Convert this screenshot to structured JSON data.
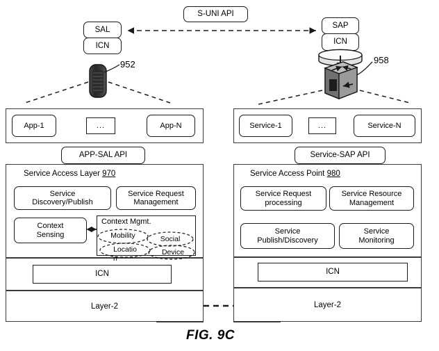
{
  "figure": {
    "caption": "FIG. 9C",
    "top_api_label": "S-UNI API"
  },
  "left": {
    "stack": {
      "top_label": "SAL",
      "bottom_label": "ICN"
    },
    "device": {
      "icon": "mobile-phone-icon",
      "ref_number": "952"
    },
    "apps_panel": {
      "items": [
        {
          "label": "App-1"
        },
        {
          "label": "..."
        },
        {
          "label": "App-N"
        }
      ]
    },
    "api_label": "APP-SAL API",
    "layer_panel": {
      "title": "Service Access Layer",
      "ref_number": "970",
      "blocks": [
        {
          "label": "Service\nDiscovery/Publish"
        },
        {
          "label": "Service Request\nManagement"
        },
        {
          "label": "Context\nSensing"
        }
      ],
      "context_mgmt": {
        "title": "Context Mgmt.",
        "ellipses": [
          {
            "label": "Mobility"
          },
          {
            "label": "Social"
          },
          {
            "label": "Locatio"
          },
          {
            "label": "Device"
          }
        ],
        "clipped_char": "n"
      },
      "icn_label": "ICN",
      "layer2_label": "Layer-2"
    }
  },
  "right": {
    "stack": {
      "top_label": "SAP",
      "bottom_label": "ICN"
    },
    "device": {
      "icon": "server-cube-icon",
      "ref_number": "958"
    },
    "services_panel": {
      "items": [
        {
          "label": "Service-1"
        },
        {
          "label": "..."
        },
        {
          "label": "Service-N"
        }
      ]
    },
    "api_label": "Service-SAP API",
    "point_panel": {
      "title": "Service Access Point",
      "ref_number": "980",
      "blocks": [
        {
          "label": "Service  Request\nprocessing"
        },
        {
          "label": "Service Resource\nManagement"
        },
        {
          "label": "Service\nPublish/Discovery"
        },
        {
          "label": "Service\nMonitoring"
        }
      ],
      "icn_label": "ICN",
      "layer2_label": "Layer-2"
    }
  },
  "colors": {
    "line": "#1a1a1a",
    "panel_border": "#3a3a3a",
    "background": "#ffffff"
  }
}
